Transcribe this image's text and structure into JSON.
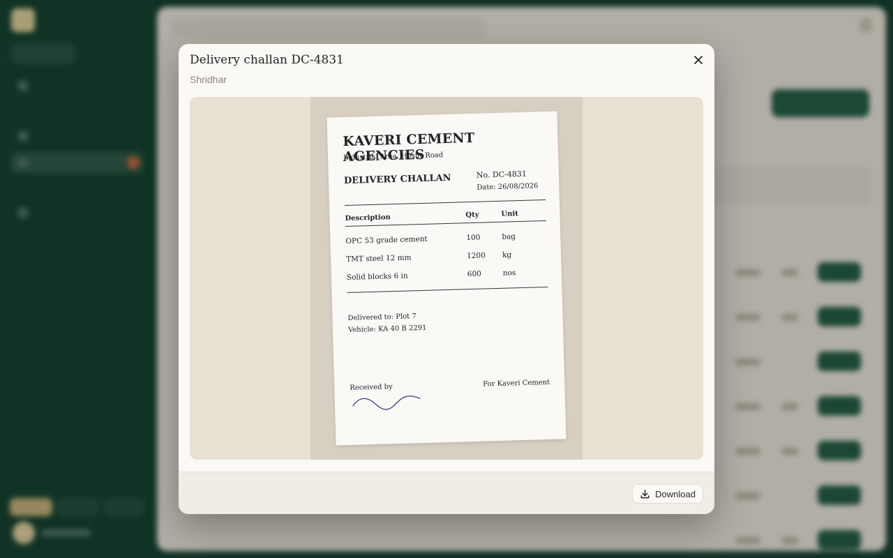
{
  "modal": {
    "title": "Delivery challan DC-4831",
    "subtitle": "Shridhar",
    "download_label": "Download"
  },
  "document": {
    "company": "KAVERI CEMENT AGENCIES",
    "address": "Industrial Area, Hosur Road",
    "doc_type": "DELIVERY CHALLAN",
    "number": "No. DC-4831",
    "date": "Date: 26/08/2026",
    "columns": [
      "Description",
      "Qty",
      "Unit"
    ],
    "items": [
      {
        "description": "OPC 53 grade cement",
        "qty": "100",
        "unit": "bag"
      },
      {
        "description": "TMT steel 12 mm",
        "qty": "1200",
        "unit": "kg"
      },
      {
        "description": "Solid blocks 6 in",
        "qty": "600",
        "unit": "nos"
      }
    ],
    "delivered_to": "Delivered to: Plot 7",
    "vehicle": "Vehicle: KA 40 B 2291",
    "received_by": "Received by",
    "for_company": "For Kaveri Cement"
  },
  "icons": {
    "close": "close-icon",
    "download": "download-icon"
  },
  "colors": {
    "sidebar": "#103e2c",
    "accent": "#1f5a40",
    "signature_ink": "#2b3f86"
  }
}
